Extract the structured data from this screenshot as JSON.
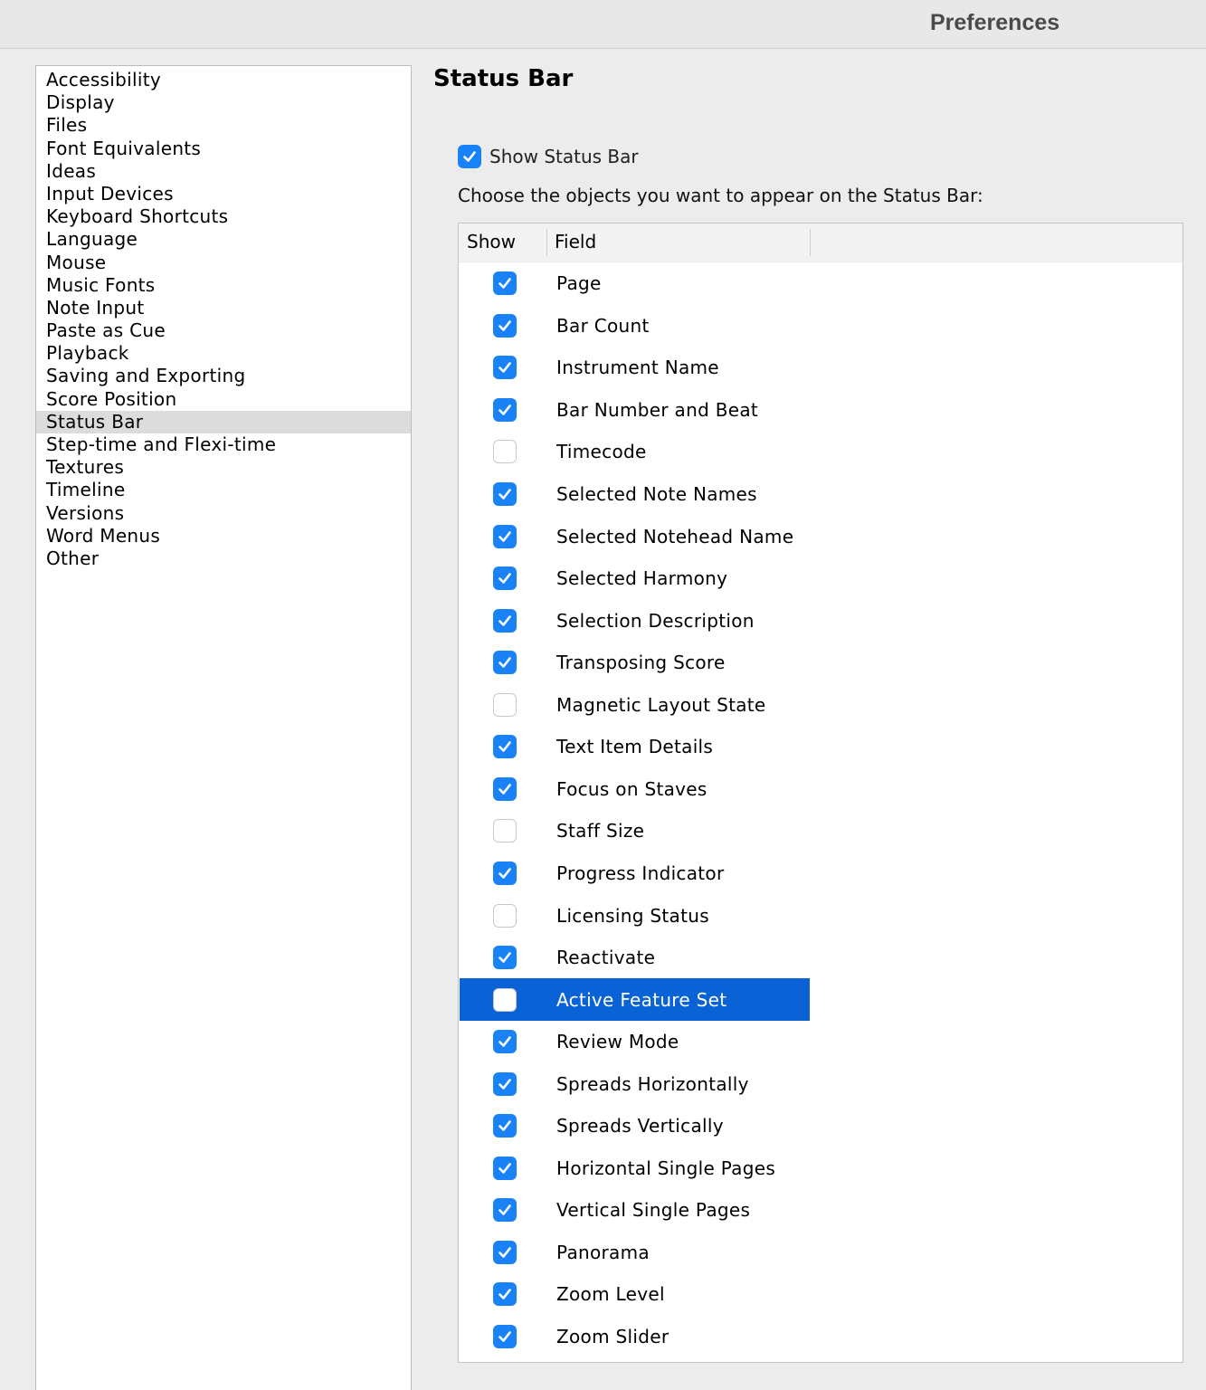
{
  "window": {
    "title": "Preferences"
  },
  "sidebar": {
    "selected": "Status Bar",
    "items": [
      "Accessibility",
      "Display",
      "Files",
      "Font Equivalents",
      "Ideas",
      "Input Devices",
      "Keyboard Shortcuts",
      "Language",
      "Mouse",
      "Music Fonts",
      "Note Input",
      "Paste as Cue",
      "Playback",
      "Saving and Exporting",
      "Score Position",
      "Status Bar",
      "Step-time and Flexi-time",
      "Textures",
      "Timeline",
      "Versions",
      "Word Menus",
      "Other"
    ]
  },
  "panel": {
    "title": "Status Bar",
    "show_status_bar": {
      "label": "Show Status Bar",
      "checked": true
    },
    "instruction": "Choose the objects you want to appear on the Status Bar:",
    "table": {
      "headers": {
        "show": "Show",
        "field": "Field"
      },
      "selected_row": "Active Feature Set",
      "rows": [
        {
          "field": "Page",
          "show": true
        },
        {
          "field": "Bar Count",
          "show": true
        },
        {
          "field": "Instrument Name",
          "show": true
        },
        {
          "field": "Bar Number and Beat",
          "show": true
        },
        {
          "field": "Timecode",
          "show": false
        },
        {
          "field": "Selected Note Names",
          "show": true
        },
        {
          "field": "Selected Notehead Name",
          "show": true
        },
        {
          "field": "Selected Harmony",
          "show": true
        },
        {
          "field": "Selection Description",
          "show": true
        },
        {
          "field": "Transposing Score",
          "show": true
        },
        {
          "field": "Magnetic Layout State",
          "show": false
        },
        {
          "field": "Text Item Details",
          "show": true
        },
        {
          "field": "Focus on Staves",
          "show": true
        },
        {
          "field": "Staff Size",
          "show": false
        },
        {
          "field": "Progress Indicator",
          "show": true
        },
        {
          "field": "Licensing Status",
          "show": false
        },
        {
          "field": "Reactivate",
          "show": true
        },
        {
          "field": "Active Feature Set",
          "show": false
        },
        {
          "field": "Review Mode",
          "show": true
        },
        {
          "field": "Spreads Horizontally",
          "show": true
        },
        {
          "field": "Spreads Vertically",
          "show": true
        },
        {
          "field": "Horizontal Single Pages",
          "show": true
        },
        {
          "field": "Vertical Single Pages",
          "show": true
        },
        {
          "field": "Panorama",
          "show": true
        },
        {
          "field": "Zoom Level",
          "show": true
        },
        {
          "field": "Zoom Slider",
          "show": true
        }
      ]
    }
  },
  "colors": {
    "accent": "#1a82f7",
    "selection": "#0a63d6"
  }
}
